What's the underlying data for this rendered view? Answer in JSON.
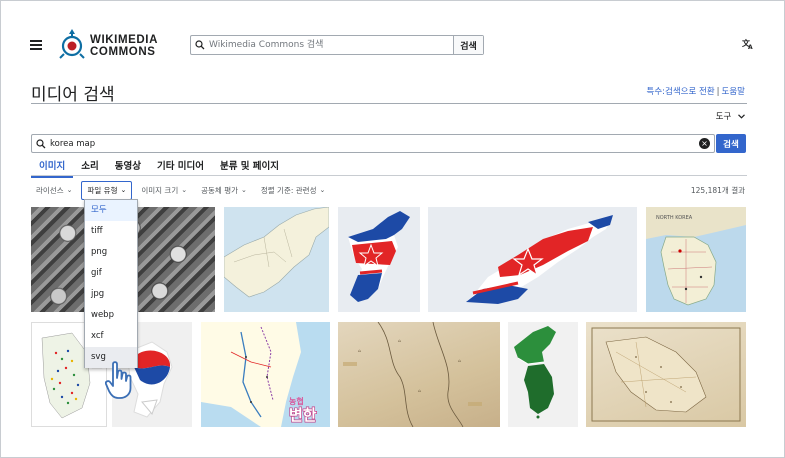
{
  "header": {
    "logo_line1": "WIKIMEDIA",
    "logo_line2": "COMMONS",
    "search_placeholder": "Wikimedia Commons 검색",
    "search_button": "검색",
    "language_icon": "translate-icon"
  },
  "page": {
    "title": "미디어 검색",
    "link_special_search": "특수:검색으로 전환",
    "link_separator": "|",
    "link_help": "도움말",
    "tools_label": "도구"
  },
  "search": {
    "query": "korea map",
    "button": "검색"
  },
  "tabs": [
    {
      "label": "이미지",
      "active": true
    },
    {
      "label": "소리",
      "active": false
    },
    {
      "label": "동영상",
      "active": false
    },
    {
      "label": "기타 미디어",
      "active": false
    },
    {
      "label": "분류 및 페이지",
      "active": false
    }
  ],
  "filters": [
    {
      "label": "라이선스"
    },
    {
      "label": "파일 유형",
      "open": true
    },
    {
      "label": "이미지 크기"
    },
    {
      "label": "공동체 평가"
    },
    {
      "label": "정렬 기준: 관련성"
    }
  ],
  "result_count": "125,181개 결과",
  "filetype_dropdown": {
    "options": [
      "모두",
      "tiff",
      "png",
      "gif",
      "jpg",
      "webp",
      "xcf",
      "svg"
    ],
    "selected": "모두",
    "hover": "svg"
  },
  "thumb_overlay_text": {
    "badge_top": "농협",
    "badge_main": "변한"
  },
  "colors": {
    "accent": "#3366cc",
    "korea_red": "#e22526",
    "korea_blue": "#1d4aa6",
    "korea_green": "#2c8f3c"
  }
}
